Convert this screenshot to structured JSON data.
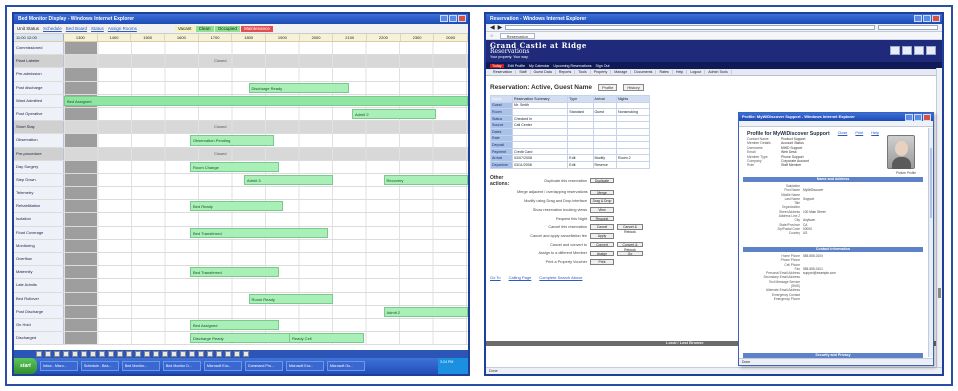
{
  "left_window": {
    "title": "Bed Monitor Display - Windows Internet Explorer",
    "header": {
      "label": "Unit Status",
      "links": [
        "Schedule",
        "Bed Board",
        "Status",
        "Assign Rooms"
      ],
      "legend": [
        "Vacant",
        "Clean",
        "Occupied",
        "Maintenance"
      ],
      "footer_links": [
        "Schedule",
        "Bed Board",
        "Status"
      ]
    },
    "timeline": {
      "corner": "11:00  12:00",
      "columns": [
        "1300",
        "1400",
        "1500",
        "1600",
        "1700",
        "1800",
        "1900",
        "2000",
        "2100",
        "2200",
        "2300",
        "0000"
      ]
    },
    "rows": [
      {
        "label": "Commissioned",
        "blocked": false
      },
      {
        "label": "Plant Labeler",
        "blocked": true,
        "note": "Closed"
      },
      {
        "label": "Pre-admission",
        "blocked": false
      },
      {
        "label": "Post discharge",
        "blocked": false,
        "bar": "Discharge Ready"
      },
      {
        "label": "Ward Admitted",
        "blocked": false,
        "bar": "Bed Assigned"
      },
      {
        "label": "Post Operative",
        "blocked": false,
        "bar": "Admit 2"
      },
      {
        "label": "Short Stay",
        "blocked": true,
        "note": "Closed"
      },
      {
        "label": "Observation",
        "blocked": false,
        "bar": "Observation Pending"
      },
      {
        "label": "Pre-procedure",
        "blocked": true,
        "note": "Closed"
      },
      {
        "label": "Day Surgery",
        "blocked": false,
        "bar": "Room Change"
      },
      {
        "label": "Step Down",
        "blocked": false,
        "bar": "Admit 3",
        "bar2": "Recovery"
      },
      {
        "label": "Telemetry",
        "blocked": false
      },
      {
        "label": "Rehabilitation",
        "blocked": false,
        "bar": "Bed Ready"
      },
      {
        "label": "Isolation",
        "blocked": false
      },
      {
        "label": "Float Coverage",
        "blocked": false,
        "bar": "Bed Transferred"
      },
      {
        "label": "Monitoring",
        "blocked": false
      },
      {
        "label": "Overflow",
        "blocked": false
      },
      {
        "label": "Maternity",
        "blocked": false,
        "bar": "Bed Transferred"
      },
      {
        "label": "Late Admits",
        "blocked": false
      },
      {
        "label": "Bed Rollover",
        "blocked": false,
        "bar": "Room Ready"
      },
      {
        "label": "Post Discharge",
        "blocked": false,
        "bar": "Admit 2"
      },
      {
        "label": "On Hold",
        "blocked": false,
        "bar": "Bed Assigned"
      },
      {
        "label": "Discharged",
        "blocked": false,
        "bar": "Discharge Ready",
        "bar2": "Ready Cell"
      }
    ],
    "taskbar": {
      "start": "start",
      "items": [
        "Inbox - Micro...",
        "Schedule - Bea...",
        "Bed Monitor...",
        "Bed Monitor D...",
        "Microsoft Exc...",
        "Command Pro...",
        "Microsoft Exc...",
        "Microsoft Ou..."
      ],
      "clock": "3:24 PM"
    }
  },
  "right_window": {
    "title": "Reservation - Windows Internet Explorer",
    "tab": "Reservation",
    "brand": {
      "line1": "Grand Castle at Ridge",
      "line2": "Reservations",
      "tagline": "Your property. Your way."
    },
    "navstrip": [
      "Edit Profile",
      "My Calendar",
      "Upcoming Reservations",
      "Sign Out"
    ],
    "alert": "Today",
    "menu": [
      "Reservation",
      "Staff",
      "Guest Data",
      "Reports",
      "Tools",
      "Property",
      "Manage",
      "Documents",
      "Rates",
      "Help",
      "Logout",
      "Admin Tools"
    ],
    "reservation": {
      "heading": "Reservation: Active, Guest Name",
      "buttons": [
        "Profile",
        "History"
      ],
      "table": {
        "header": [
          "Name",
          "Reservation Summary",
          "Type",
          "Arrival",
          "Nights"
        ],
        "rows": [
          [
            "Guest",
            "Mr. Smith",
            "",
            "",
            ""
          ],
          [
            "Room",
            "",
            "Standard",
            "Guest",
            "Nonsmoking"
          ],
          [
            "Status",
            "Checked In",
            "",
            "",
            ""
          ],
          [
            "Source",
            "Call Center",
            "",
            "",
            ""
          ],
          [
            "Dates",
            "",
            "",
            "",
            ""
          ],
          [
            "Rate",
            "",
            "",
            "",
            ""
          ],
          [
            "Deposit",
            "",
            "",
            "",
            ""
          ],
          [
            "Payment",
            "Credit Card",
            "",
            "",
            ""
          ],
          [
            "Arrival",
            "03/07/2008",
            "Edit",
            "Modify",
            "Room 2"
          ],
          [
            "Departure",
            "03/11/2008",
            "Edit",
            "Reserve",
            ""
          ]
        ]
      }
    },
    "other_actions": {
      "heading": "Other actions:",
      "items": [
        {
          "desc": "Duplicate this reservation",
          "button": "Duplicate"
        },
        {
          "desc": "Merge adjacent / overlapping reservations",
          "button": "Merge"
        },
        {
          "desc": "Modify using Drag and Drop interface",
          "button": "Drag & Drop"
        },
        {
          "desc": "Show reservation booking views",
          "button": "View"
        },
        {
          "desc": "Request this Night",
          "button": "Request"
        },
        {
          "desc": "Cancel this reservation",
          "button": "Cancel",
          "button2": "Cancel & Rebook"
        },
        {
          "desc": "Cancel and apply cancellation fee",
          "button": "Apply"
        },
        {
          "desc": "Cancel and convert to",
          "button": "Convert",
          "button2": "Convert & Rebook"
        },
        {
          "desc": "Assign to a different Member",
          "button": "Assign",
          "button2": "Go"
        },
        {
          "desc": "Print a Property Voucher",
          "button": "Print"
        }
      ]
    },
    "links": [
      "Go To",
      "Calling Page",
      "Complete Search Above"
    ],
    "footer_label": "Local / Last Browse",
    "statusbar": "Done"
  },
  "popup": {
    "title": "Profile: MyWiDiscover Support - Windows Internet Explorer",
    "heading": "Profile for MyWiDiscover Support",
    "links": [
      "Close",
      "Print",
      "Help"
    ],
    "summary": [
      {
        "k": "Contact Name",
        "v": "Product Support"
      },
      {
        "k": "Member Details",
        "v": "Account Status"
      },
      {
        "k": "Username",
        "v": "MWD Support"
      },
      {
        "k": "Email",
        "v": "Web Desk"
      },
      {
        "k": "Member Type",
        "v": "Phone Support"
      },
      {
        "k": "Company",
        "v": "Corporate Account"
      },
      {
        "k": "Role",
        "v": "Staff Member"
      }
    ],
    "photo_caption": "Picture Profile",
    "sections": [
      {
        "title": "Name and Address",
        "items": [
          {
            "k": "Salutation",
            "v": ""
          },
          {
            "k": "First Name",
            "v": "MyWiDiscover"
          },
          {
            "k": "Middle Name",
            "v": ""
          },
          {
            "k": "Last Name",
            "v": "Support"
          },
          {
            "k": "Title",
            "v": ""
          },
          {
            "k": "Organization",
            "v": ""
          },
          {
            "k": "Street Address",
            "v": "100 Main Street"
          },
          {
            "k": "Address Line 2",
            "v": ""
          },
          {
            "k": "City",
            "v": "Anytown"
          },
          {
            "k": "State/Province",
            "v": "CA"
          },
          {
            "k": "Zip/Postal Code",
            "v": "00000"
          },
          {
            "k": "Country",
            "v": "US"
          }
        ]
      },
      {
        "title": "Contact Information",
        "items": [
          {
            "k": "Home Phone",
            "v": "555-555-0100"
          },
          {
            "k": "Phone Phone",
            "v": ""
          },
          {
            "k": "Cell Phone",
            "v": ""
          },
          {
            "k": "Fax",
            "v": "555-555-0101"
          },
          {
            "k": "Personal Email Address",
            "v": "support@example.com"
          },
          {
            "k": "Secondary Email Address",
            "v": ""
          },
          {
            "k": "Text Message Service (SMS)",
            "v": ""
          },
          {
            "k": "Alternate Email Address",
            "v": ""
          },
          {
            "k": "Emergency Contact",
            "v": ""
          },
          {
            "k": "Emergency Phone",
            "v": ""
          }
        ]
      },
      {
        "title": "Security and Privacy",
        "items": [
          {
            "k": "Username",
            "v": ""
          }
        ]
      }
    ],
    "statusbar": "Done"
  },
  "colors": {
    "frame": "#2b4ea8",
    "bar_green": "#a8efb8",
    "banner": "#1f2b7a",
    "titlebar": "#1d4bb5"
  }
}
